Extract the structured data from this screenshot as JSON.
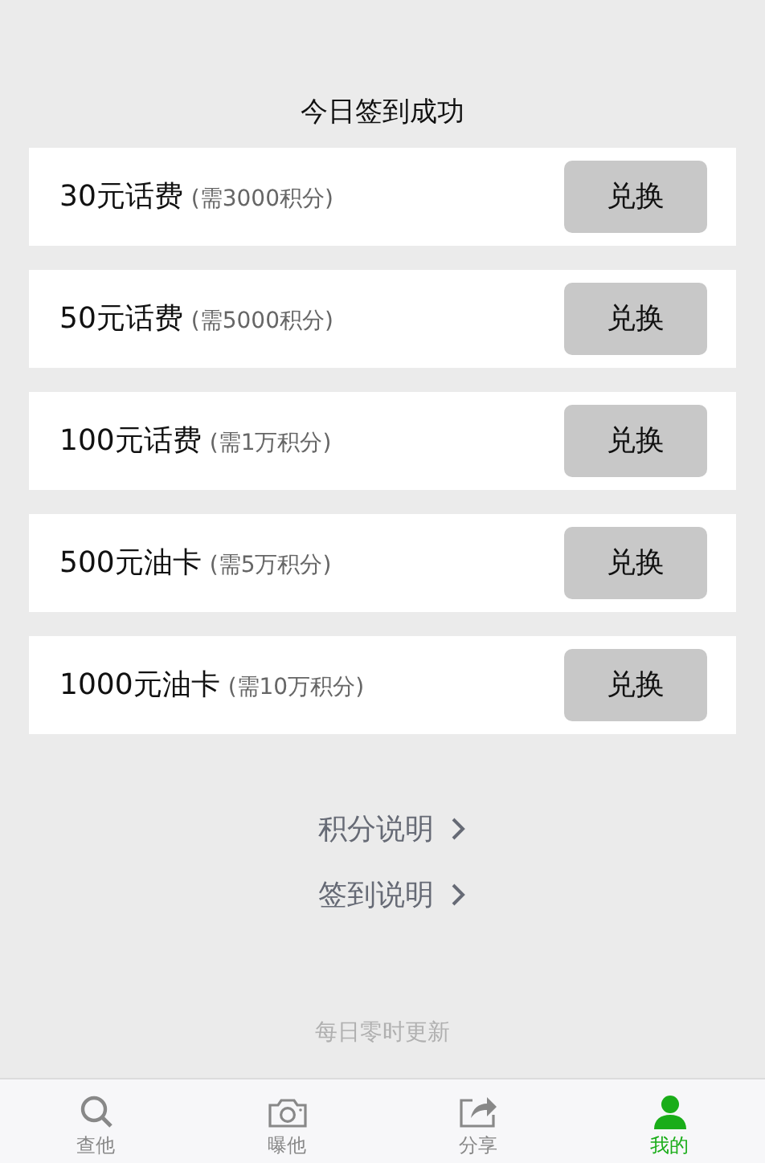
{
  "status": "今日签到成功",
  "rewards": [
    {
      "name": "30元话费",
      "cost": "(需3000积分)",
      "button": "兑换"
    },
    {
      "name": "50元话费",
      "cost": "(需5000积分)",
      "button": "兑换"
    },
    {
      "name": "100元话费",
      "cost": "(需1万积分)",
      "button": "兑换"
    },
    {
      "name": "500元油卡",
      "cost": "(需5万积分)",
      "button": "兑换"
    },
    {
      "name": "1000元油卡",
      "cost": "(需10万积分)",
      "button": "兑换"
    }
  ],
  "links": [
    "积分说明",
    "签到说明"
  ],
  "footer_note": "每日零时更新",
  "tab_bar": [
    {
      "kind": "search",
      "label": "查他",
      "selected": false
    },
    {
      "kind": "camera",
      "label": "曝他",
      "selected": false
    },
    {
      "kind": "share",
      "label": "分享",
      "selected": false
    },
    {
      "kind": "person",
      "label": "我的",
      "selected": true
    }
  ]
}
